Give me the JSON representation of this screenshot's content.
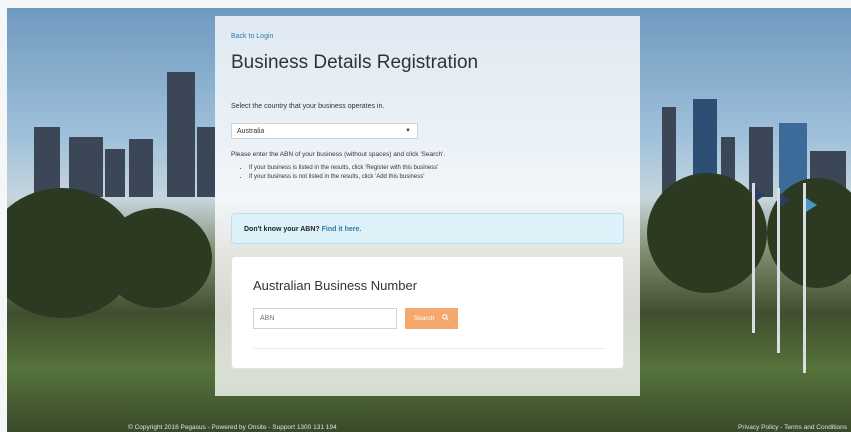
{
  "back_link": "Back to Login",
  "title": "Business Details Registration",
  "country": {
    "prompt": "Select the country that your business operates in.",
    "selected": "Australia"
  },
  "instructions": {
    "intro": "Please enter the ABN of your business (without spaces) and click 'Search'.",
    "bullets": [
      "If your business is listed in the results, click 'Register with this business'",
      "If your business is not listed in the results, click 'Add this business'"
    ]
  },
  "info": {
    "question": "Don't know your ABN?",
    "link": "Find it here."
  },
  "abn_card": {
    "title": "Australian Business Number",
    "placeholder": "ABN",
    "search_label": "Search"
  },
  "footer": {
    "copyright": "© Copyright 2018 Pegasus - Powered by Onsite - Support 1300 131 194",
    "links": "Privacy Policy - Terms and Conditions"
  }
}
